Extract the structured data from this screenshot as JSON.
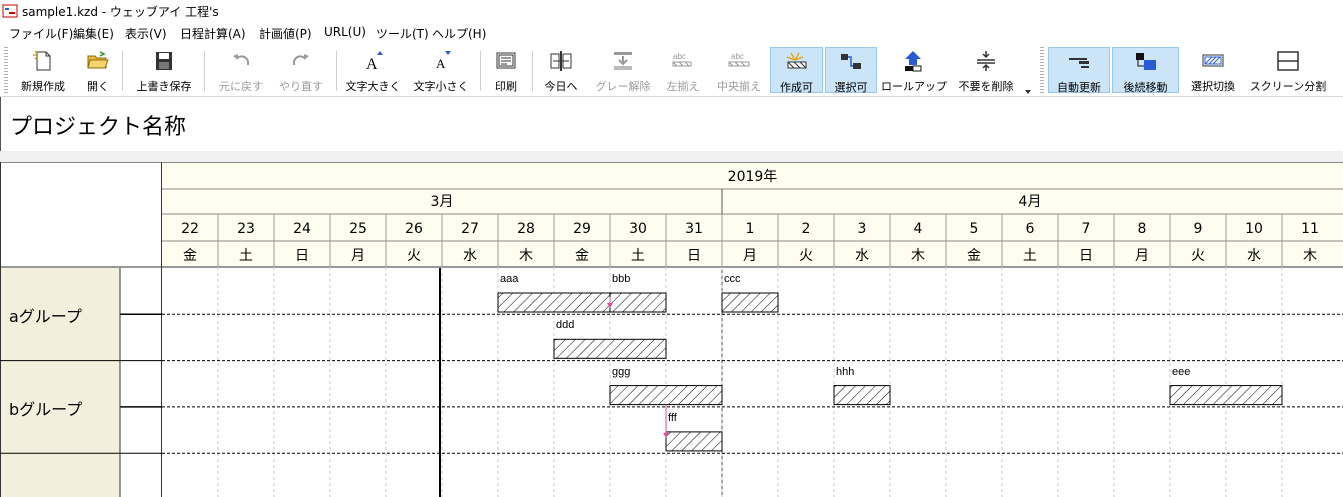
{
  "window": {
    "title": "sample1.kzd - ウェッブアイ 工程's"
  },
  "menu": [
    {
      "label": "ファイル(F)"
    },
    {
      "label": "編集(E)"
    },
    {
      "label": "表示(V)"
    },
    {
      "label": "日程計算(A)"
    },
    {
      "label": "計画値(P)"
    },
    {
      "label": "URL(U)"
    },
    {
      "label": "ツール(T)"
    },
    {
      "label": "ヘルプ(H)"
    }
  ],
  "toolbar": {
    "new": {
      "label": "新規作成"
    },
    "open": {
      "label": "開く"
    },
    "save": {
      "label": "上書き保存"
    },
    "undo": {
      "label": "元に戻す"
    },
    "redo": {
      "label": "やり直す"
    },
    "font_larger": {
      "label": "文字大きく"
    },
    "font_smaller": {
      "label": "文字小さく"
    },
    "print": {
      "label": "印刷"
    },
    "today": {
      "label": "今日へ"
    },
    "ungray": {
      "label": "グレー解除"
    },
    "align_left": {
      "label": "左揃え"
    },
    "align_center": {
      "label": "中央揃え"
    },
    "create_mode": {
      "label": "作成可"
    },
    "select_mode": {
      "label": "選択可"
    },
    "rollup": {
      "label": "ロールアップ"
    },
    "delete_unneeded": {
      "label": "不要を削除"
    },
    "auto_update": {
      "label": "自動更新"
    },
    "successor_move": {
      "label": "後続移動"
    },
    "select_toggle": {
      "label": "選択切換"
    },
    "split_screen": {
      "label": "スクリーン分割"
    }
  },
  "project": {
    "name": "プロジェクト名称"
  },
  "calendar": {
    "year_label": "2019年",
    "months": [
      {
        "label": "3月",
        "start": 0,
        "count": 10
      },
      {
        "label": "4月",
        "start": 10,
        "count": 11
      }
    ],
    "days": [
      {
        "d": "22",
        "w": "金"
      },
      {
        "d": "23",
        "w": "土"
      },
      {
        "d": "24",
        "w": "日"
      },
      {
        "d": "25",
        "w": "月"
      },
      {
        "d": "26",
        "w": "火"
      },
      {
        "d": "27",
        "w": "水"
      },
      {
        "d": "28",
        "w": "木"
      },
      {
        "d": "29",
        "w": "金"
      },
      {
        "d": "30",
        "w": "土"
      },
      {
        "d": "31",
        "w": "日"
      },
      {
        "d": "1",
        "w": "月"
      },
      {
        "d": "2",
        "w": "火"
      },
      {
        "d": "3",
        "w": "水"
      },
      {
        "d": "4",
        "w": "木"
      },
      {
        "d": "5",
        "w": "金"
      },
      {
        "d": "6",
        "w": "土"
      },
      {
        "d": "7",
        "w": "日"
      },
      {
        "d": "8",
        "w": "月"
      },
      {
        "d": "9",
        "w": "火"
      },
      {
        "d": "10",
        "w": "水"
      },
      {
        "d": "11",
        "w": "木"
      }
    ],
    "today_index": 5
  },
  "groups": [
    {
      "name": "aグループ"
    },
    {
      "name": "bグループ"
    }
  ],
  "tasks": [
    {
      "name": "aaa",
      "row": 0,
      "start": 6,
      "days": 2
    },
    {
      "name": "bbb",
      "row": 0,
      "start": 8,
      "days": 1
    },
    {
      "name": "ccc",
      "row": 0,
      "start": 10,
      "days": 1
    },
    {
      "name": "ddd",
      "row": 1,
      "start": 7,
      "days": 2
    },
    {
      "name": "ggg",
      "row": 2,
      "start": 8,
      "days": 2
    },
    {
      "name": "hhh",
      "row": 2,
      "start": 12,
      "days": 1
    },
    {
      "name": "eee",
      "row": 2,
      "start": 18,
      "days": 2
    },
    {
      "name": "fff",
      "row": 3,
      "start": 9,
      "days": 1
    }
  ],
  "colors": {
    "header_bg": "#fefef0",
    "group_bg": "#f2f0dc",
    "today_line": "#000000",
    "link_arrow": "#e04a9c"
  }
}
